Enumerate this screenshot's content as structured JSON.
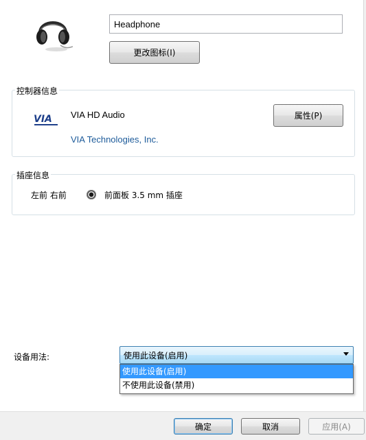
{
  "device": {
    "icon": "headphone-icon",
    "name_value": "Headphone",
    "change_icon_label": "更改图标(I)"
  },
  "controller": {
    "legend": "控制器信息",
    "logo": "VIA",
    "name": "VIA HD Audio",
    "vendor": "VIA Technologies, Inc.",
    "properties_label": "属性(P)"
  },
  "jack": {
    "legend": "插座信息",
    "position": "左前 右前",
    "description": "前面板 3.5 mm 插座"
  },
  "usage": {
    "label": "设备用法:",
    "selected": "使用此设备(启用)",
    "options": [
      "使用此设备(启用)",
      "不使用此设备(禁用)"
    ]
  },
  "footer": {
    "ok": "确定",
    "cancel": "取消",
    "apply": "应用(A)"
  },
  "colors": {
    "vendor_link": "#1d5b9a",
    "selection": "#3399ff"
  }
}
